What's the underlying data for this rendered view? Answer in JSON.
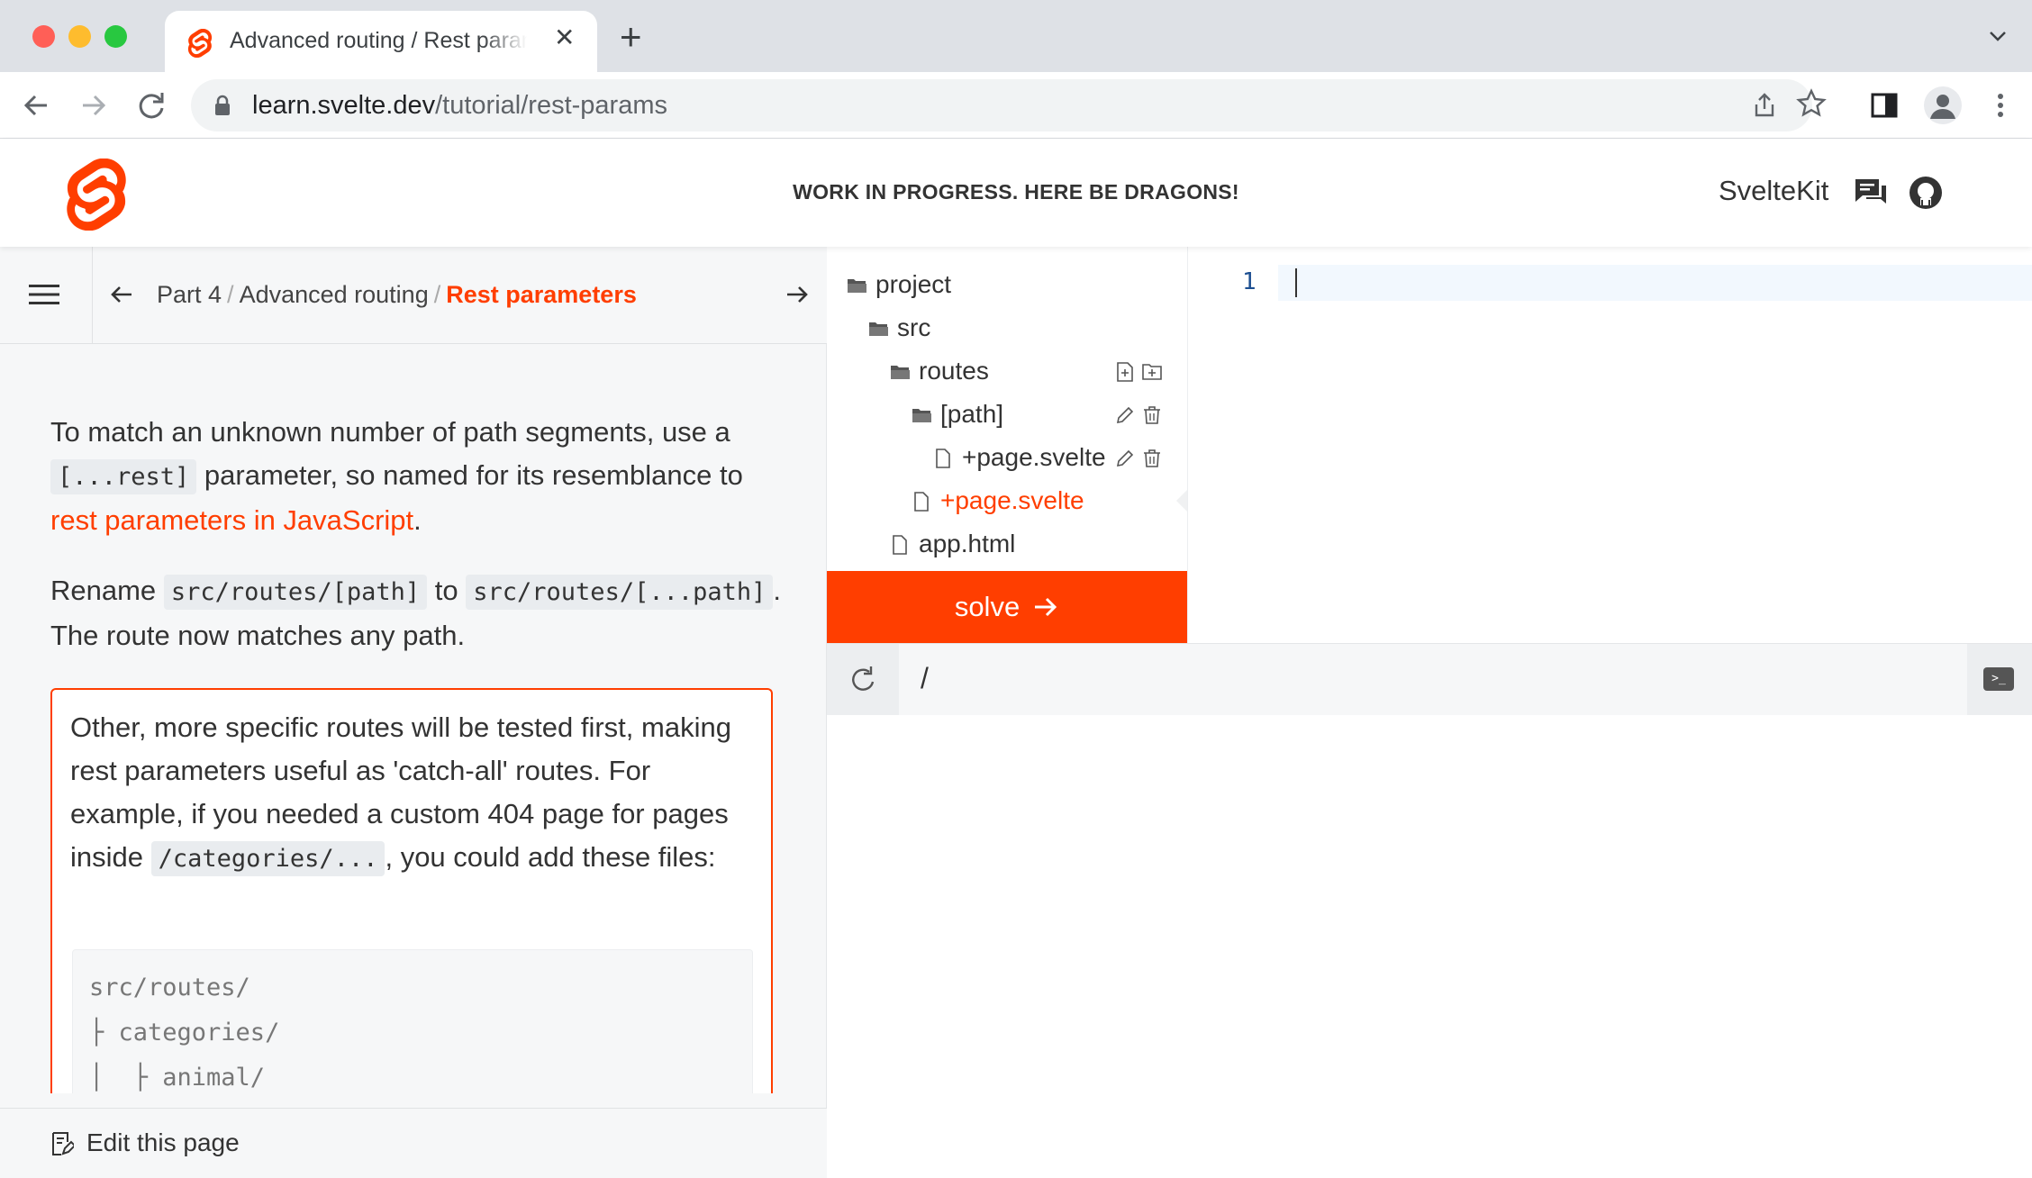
{
  "browser": {
    "tab_title": "Advanced routing / Rest parameters",
    "url_host": "learn.svelte.dev",
    "url_path": "/tutorial/rest-params"
  },
  "header": {
    "banner": "WORK IN PROGRESS. HERE BE DRAGONS!",
    "brand": "SvelteKit"
  },
  "breadcrumb": {
    "part": "Part 4",
    "section": "Advanced routing",
    "current": "Rest parameters"
  },
  "content": {
    "p1_a": "To match an unknown number of path segments, use a",
    "p1_code": "[...rest]",
    "p1_b": " parameter, so named for its resemblance to",
    "p1_link": "rest parameters in JavaScript",
    "p1_c": ".",
    "p2_a": "Rename",
    "p2_code1": "src/routes/[path]",
    "p2_b": "to",
    "p2_code2": "src/routes/[...path]",
    "p2_c": ".",
    "p2_d": "The route now matches any path.",
    "callout_a": "Other, more specific routes will be tested first, making rest parameters useful as 'catch-all' routes. For example, if you needed a custom 404 page for pages inside",
    "callout_code": "/categories/...",
    "callout_b": ", you could add these files:",
    "code_lines": [
      "src/routes/",
      "├ categories/",
      "│  ├ animal/"
    ]
  },
  "footer": {
    "edit_label": "Edit this page"
  },
  "filetree": {
    "nodes": [
      "project",
      "src",
      "routes",
      "[path]",
      "+page.svelte",
      "+page.svelte",
      "app.html"
    ]
  },
  "solve_label": "solve",
  "editor": {
    "line_number": "1"
  },
  "preview": {
    "address": "/",
    "terminal_glyph": ">_"
  },
  "colors": {
    "accent": "#ff3e00"
  }
}
